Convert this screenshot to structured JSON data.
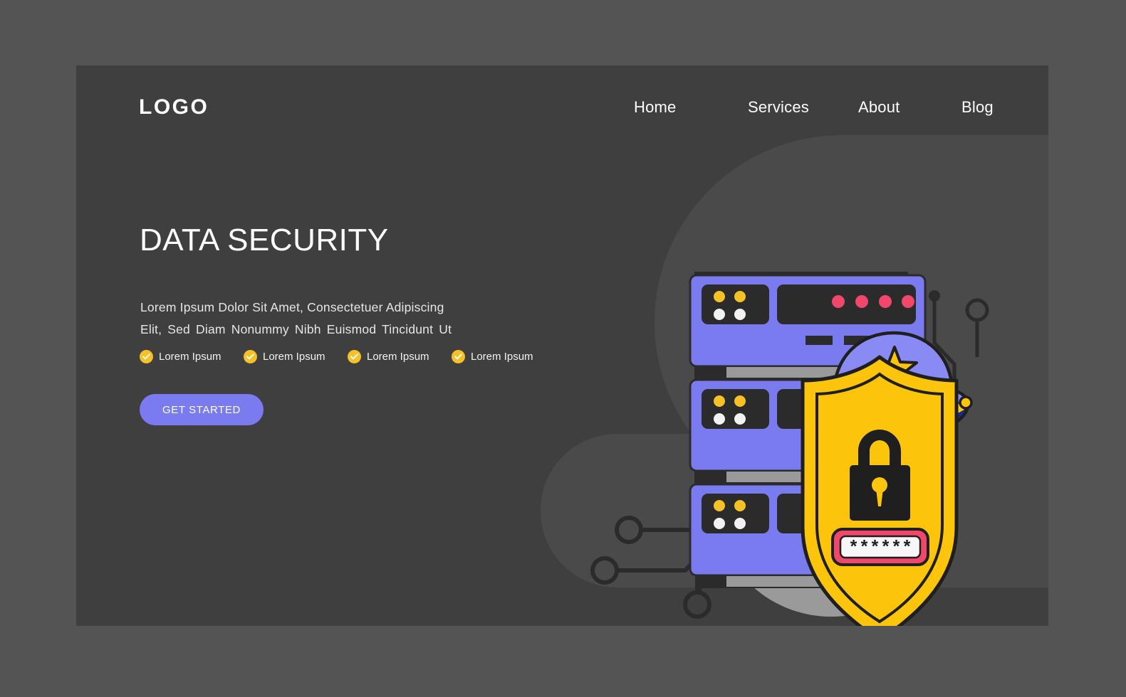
{
  "page": {
    "background_color": "#545454",
    "card_color": "#3f3f3f"
  },
  "header": {
    "logo": "LOGO",
    "nav": [
      {
        "label": "Home"
      },
      {
        "label": "Services"
      },
      {
        "label": "About"
      },
      {
        "label": "Blog"
      }
    ]
  },
  "hero": {
    "title": "DATA SECURITY",
    "subtitle_line1": "Lorem Ipsum Dolor Sit Amet, Consectetuer Adipiscing",
    "subtitle_line2": "Elit, Sed Diam Nonummy Nibh Euismod Tincidunt Ut",
    "features": [
      {
        "label": "Lorem Ipsum",
        "icon": "check-circle-icon"
      },
      {
        "label": "Lorem Ipsum",
        "icon": "check-circle-icon"
      },
      {
        "label": "Lorem Ipsum",
        "icon": "check-circle-icon"
      },
      {
        "label": "Lorem Ipsum",
        "icon": "check-circle-icon"
      }
    ],
    "cta_label": "GET STARTED"
  },
  "illustration": {
    "name": "data-security-illustration",
    "password_field_value": "******",
    "colors": {
      "server_body": "#7b7bf0",
      "server_screen": "#2b2b2b",
      "shield_yellow": "#fcc50b",
      "shield_outline": "#1f1f1f",
      "cap_crown": "#8a8af5",
      "cap_brim": "#1b2a8f",
      "cap_star": "#fcc50b",
      "password_box": "#f0476b",
      "led_pink": "#f0476b",
      "led_yellow": "#f5c126",
      "led_white": "#f2f2f2",
      "circle_backdrop": "#9a9a9a",
      "rack_rail": "#9a9a9a",
      "circuit_line": "#2b2b2b"
    },
    "servers": [
      {
        "name": "server-unit-top",
        "leds": [
          "pink",
          "pink",
          "pink",
          "pink"
        ]
      },
      {
        "name": "server-unit-middle",
        "leds": [
          "pink"
        ]
      },
      {
        "name": "server-unit-bottom",
        "leds": [
          "yellow"
        ]
      }
    ]
  }
}
